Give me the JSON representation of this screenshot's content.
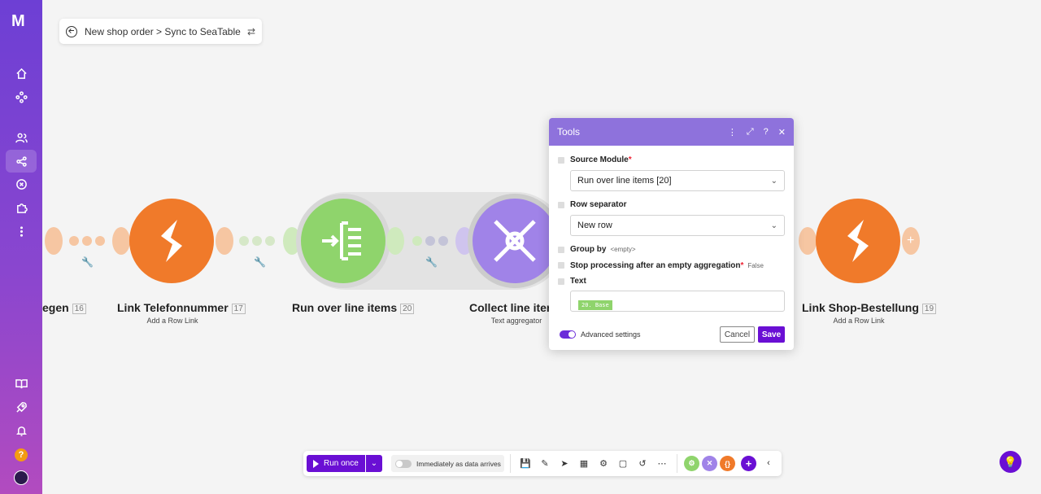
{
  "breadcrumb": {
    "text": "New shop order > Sync to SeaTable"
  },
  "sidebar": {
    "logo": "M",
    "items": [
      "home",
      "scenarios",
      "team",
      "connections",
      "webhooks",
      "apps",
      "more"
    ],
    "bottom": [
      "docs",
      "launch",
      "notifications",
      "help",
      "profile"
    ],
    "help_label": "?"
  },
  "modules": [
    {
      "title": "egen",
      "number": "16",
      "subtitle": ""
    },
    {
      "title": "Link Telefonnummer",
      "number": "17",
      "subtitle": "Add a Row Link"
    },
    {
      "title": "Run over line items",
      "number": "20",
      "subtitle": ""
    },
    {
      "title": "Collect line iter",
      "number": "",
      "subtitle": "Text aggregator"
    },
    {
      "title": "Link Shop-Bestellung",
      "number": "19",
      "subtitle": "Add a Row Link"
    }
  ],
  "panel": {
    "title": "Tools",
    "source_module_label": "Source Module",
    "source_module_required": "*",
    "source_module_value": "Run over line items [20]",
    "row_separator_label": "Row separator",
    "row_separator_value": "New row",
    "group_by_label": "Group by",
    "group_by_hint": "<empty>",
    "stop_label": "Stop processing after an empty aggregation",
    "stop_required": "*",
    "stop_value": "False",
    "text_label": "Text",
    "text_pill": "20. Base",
    "advanced_label": "Advanced settings",
    "cancel_label": "Cancel",
    "save_label": "Save"
  },
  "toolbar": {
    "run_label": "Run once",
    "schedule_label": "Immediately as data arrives",
    "circle_c": "{}"
  },
  "colors": {
    "accent": "#6a0fd4",
    "orange": "#f07a2a",
    "green": "#8fd46c",
    "purple": "#a083e8"
  }
}
